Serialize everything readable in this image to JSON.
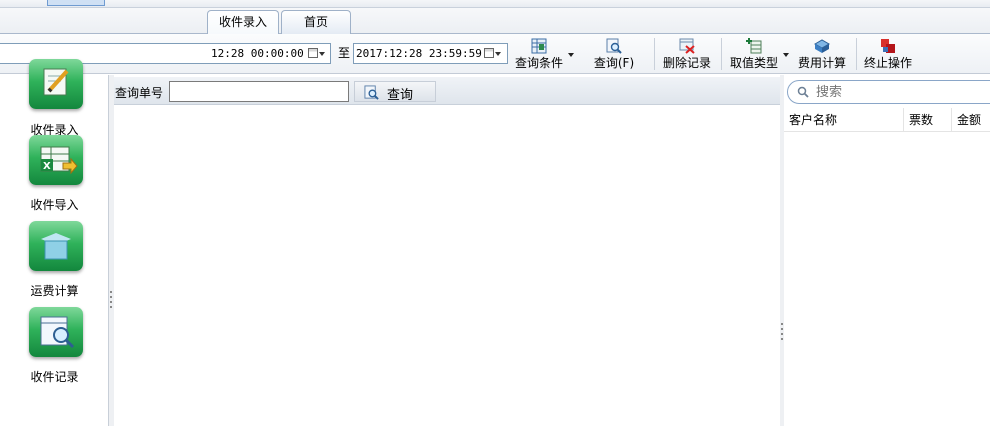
{
  "tabs": [
    {
      "label": "收件录入",
      "active": true
    },
    {
      "label": "首页",
      "active": false
    }
  ],
  "toolbar": {
    "date_from": "12:28 00:00:00",
    "date_to_sep": "至",
    "date_to": "2017:12:28 23:59:59",
    "buttons": {
      "query_condition": "查询条件",
      "query": "查询(F)",
      "delete_record": "删除记录",
      "value_type": "取值类型",
      "fee_calc": "费用计算",
      "stop_operation": "终止操作"
    }
  },
  "sidebar": {
    "items": [
      {
        "label": "收件录入",
        "icon": "pencil-edit-icon"
      },
      {
        "label": "收件导入",
        "icon": "excel-import-icon"
      },
      {
        "label": "运费计算",
        "icon": "box-calc-icon"
      },
      {
        "label": "收件记录",
        "icon": "magnifier-record-icon"
      }
    ]
  },
  "query": {
    "label": "查询单号",
    "input_value": "",
    "button": "查询"
  },
  "right_panel": {
    "search_placeholder": "搜索",
    "columns": [
      "客户名称",
      "票数",
      "金额"
    ]
  },
  "colors": {
    "tile_green": "#2fb25a",
    "border_blue": "#7f9db9"
  }
}
